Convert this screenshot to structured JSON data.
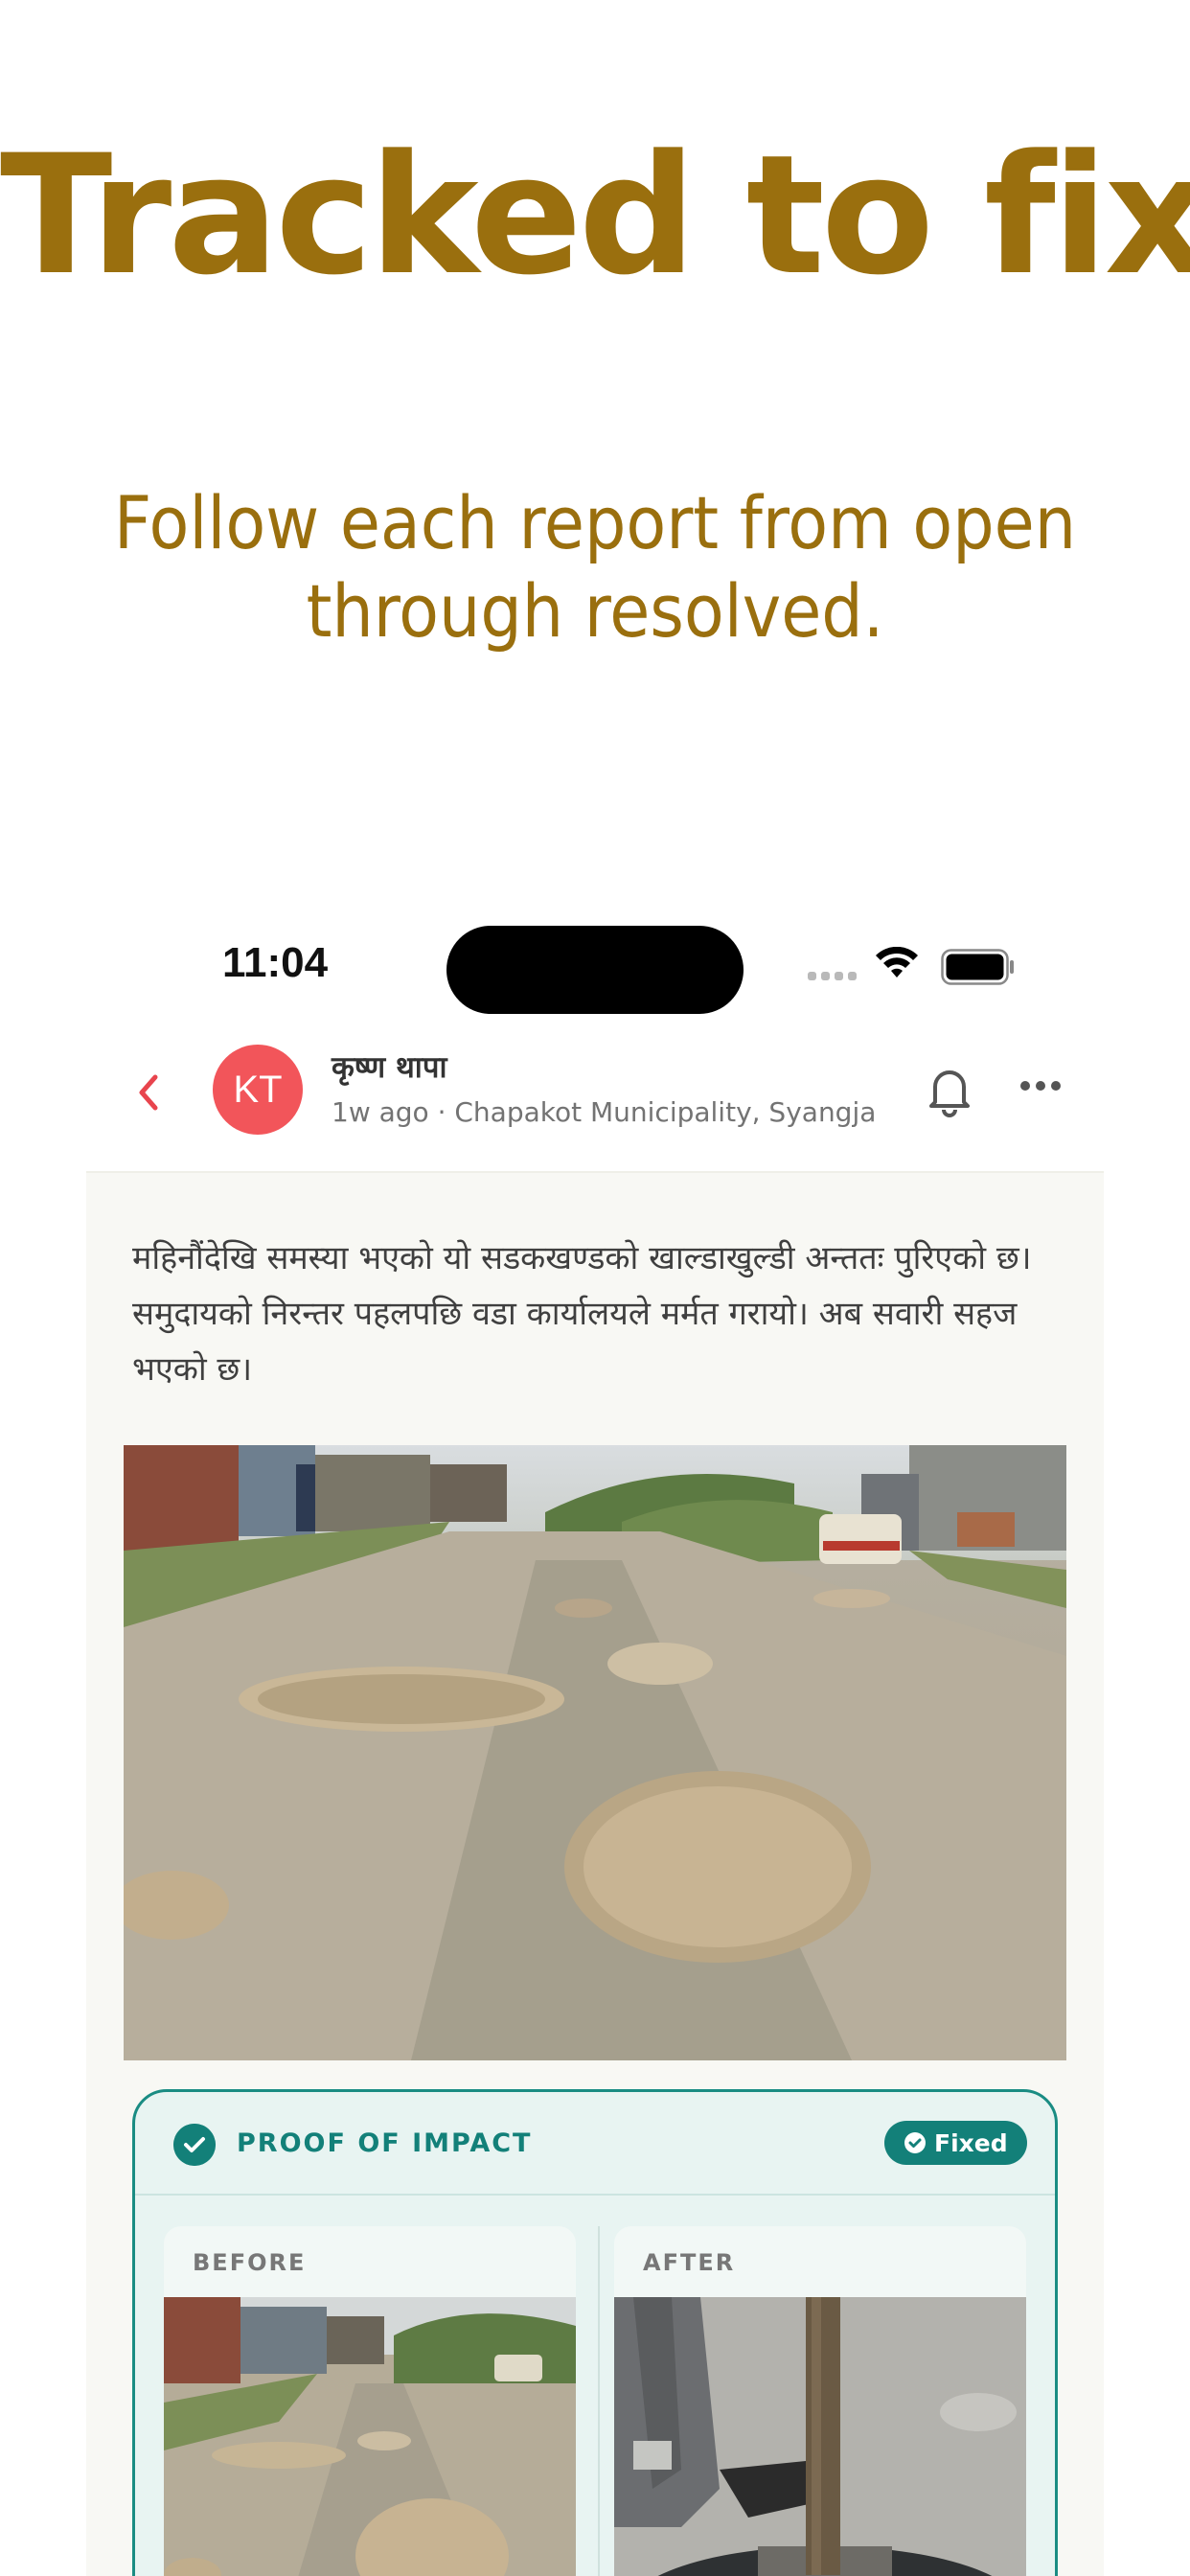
{
  "hero": {
    "title": "Tracked to fixed",
    "subtitle_line1": "Follow each report from open",
    "subtitle_line2": "through resolved."
  },
  "status_bar": {
    "time": "11:04"
  },
  "post_header": {
    "avatar_initials": "KT",
    "author_name": "कृष्ण थापा",
    "meta": "1w ago · Chapakot Municipality, Syangja",
    "accent_color": "#f2555a"
  },
  "post": {
    "body": "महिनौंदेखि समस्या भएको यो सडकखण्डको खाल्डाखुल्डी अन्ततः पुरिएको छ। समुदायको निरन्तर पहलपछि वडा कार्यालयले मर्मत गरायो। अब सवारी सहज भएको छ।"
  },
  "proof": {
    "title": "PROOF OF IMPACT",
    "badge": "Fixed",
    "before_label": "BEFORE",
    "after_label": "AFTER",
    "accent_color": "#138079"
  },
  "icons": [
    "back-chevron-icon",
    "bell-icon",
    "more-icon",
    "check-circle-icon",
    "wifi-icon",
    "battery-icon"
  ]
}
